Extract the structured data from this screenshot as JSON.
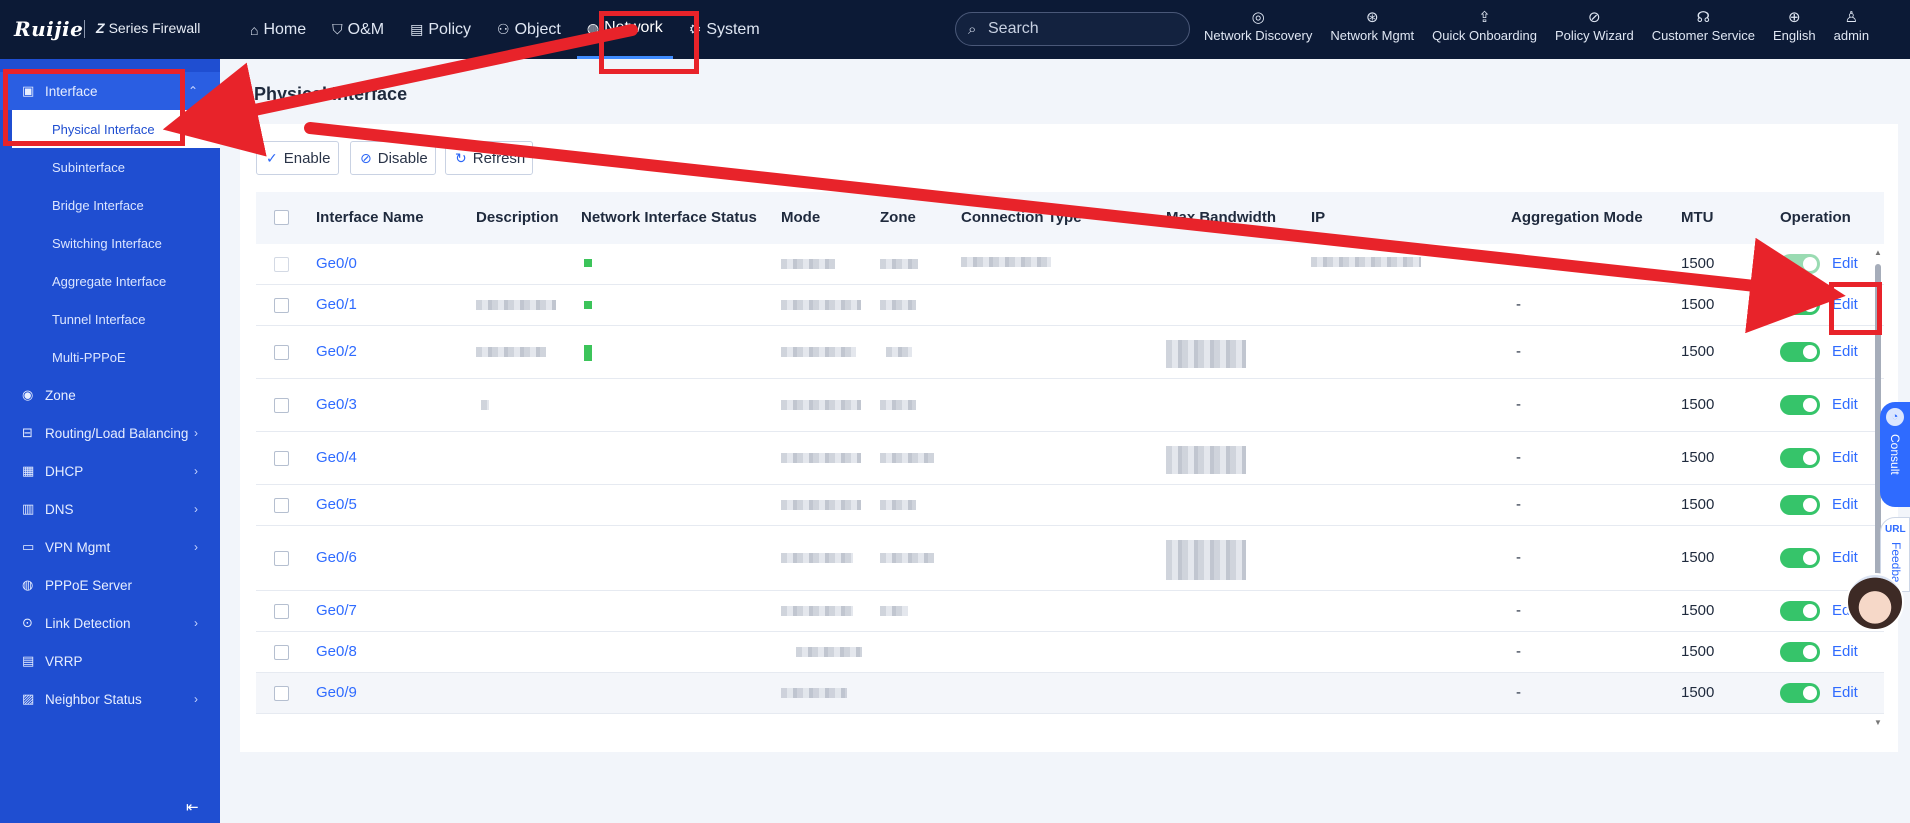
{
  "brand": {
    "logo": "Ruijie",
    "series_prefix": "Z",
    "series_text": "Series Firewall"
  },
  "topnav": {
    "items": [
      {
        "label": "Home",
        "icon": "home-icon"
      },
      {
        "label": "O&M",
        "icon": "shield-icon"
      },
      {
        "label": "Policy",
        "icon": "policy-icon"
      },
      {
        "label": "Object",
        "icon": "object-icon"
      },
      {
        "label": "Network",
        "icon": "globe-icon",
        "active": true
      },
      {
        "label": "System",
        "icon": "gear-icon"
      }
    ],
    "search_placeholder": "Search",
    "tools": [
      {
        "label": "Network Discovery",
        "icon": "radar-icon"
      },
      {
        "label": "Network Mgmt",
        "icon": "network-icon"
      },
      {
        "label": "Quick Onboarding",
        "icon": "upload-icon"
      },
      {
        "label": "Policy Wizard",
        "icon": "compass-icon"
      },
      {
        "label": "Customer Service",
        "icon": "headset-icon"
      },
      {
        "label": "English",
        "icon": "language-icon"
      },
      {
        "label": "admin",
        "icon": "user-icon"
      }
    ]
  },
  "sidebar": {
    "interface": "Interface",
    "subitems": [
      "Physical Interface",
      "Subinterface",
      "Bridge Interface",
      "Switching Interface",
      "Aggregate Interface",
      "Tunnel Interface",
      "Multi-PPPoE"
    ],
    "items": [
      "Zone",
      "Routing/Load Balancing",
      "DHCP",
      "DNS",
      "VPN Mgmt",
      "PPPoE Server",
      "Link Detection",
      "VRRP",
      "Neighbor Status"
    ]
  },
  "page": {
    "title": "Physical Interface"
  },
  "toolbar": {
    "enable": "Enable",
    "disable": "Disable",
    "refresh": "Refresh"
  },
  "table": {
    "headers": [
      "Interface Name",
      "Description",
      "Network Interface Status",
      "Mode",
      "Zone",
      "Connection Type",
      "Max Bandwidth",
      "IP",
      "Aggregation Mode",
      "MTU",
      "Operation"
    ],
    "rows": [
      {
        "name": "Ge0/0",
        "aggregation": "-",
        "mtu": "1500",
        "op": "Edit",
        "enabled": true
      },
      {
        "name": "Ge0/1",
        "aggregation": "-",
        "mtu": "1500",
        "op": "Edit",
        "enabled": true
      },
      {
        "name": "Ge0/2",
        "aggregation": "-",
        "mtu": "1500",
        "op": "Edit",
        "enabled": true
      },
      {
        "name": "Ge0/3",
        "aggregation": "-",
        "mtu": "1500",
        "op": "Edit",
        "enabled": true
      },
      {
        "name": "Ge0/4",
        "aggregation": "-",
        "mtu": "1500",
        "op": "Edit",
        "enabled": true
      },
      {
        "name": "Ge0/5",
        "aggregation": "-",
        "mtu": "1500",
        "op": "Edit",
        "enabled": true
      },
      {
        "name": "Ge0/6",
        "aggregation": "-",
        "mtu": "1500",
        "op": "Edit",
        "enabled": true
      },
      {
        "name": "Ge0/7",
        "aggregation": "-",
        "mtu": "1500",
        "op": "Edit",
        "enabled": true
      },
      {
        "name": "Ge0/8",
        "aggregation": "-",
        "mtu": "1500",
        "op": "Edit",
        "enabled": true
      },
      {
        "name": "Ge0/9",
        "aggregation": "-",
        "mtu": "1500",
        "op": "Edit",
        "enabled": true
      }
    ]
  },
  "widgets": {
    "consult": "Consult",
    "feedback": "Feedback",
    "feedback_badge": "URL"
  },
  "annotation_color": "#e8232a"
}
